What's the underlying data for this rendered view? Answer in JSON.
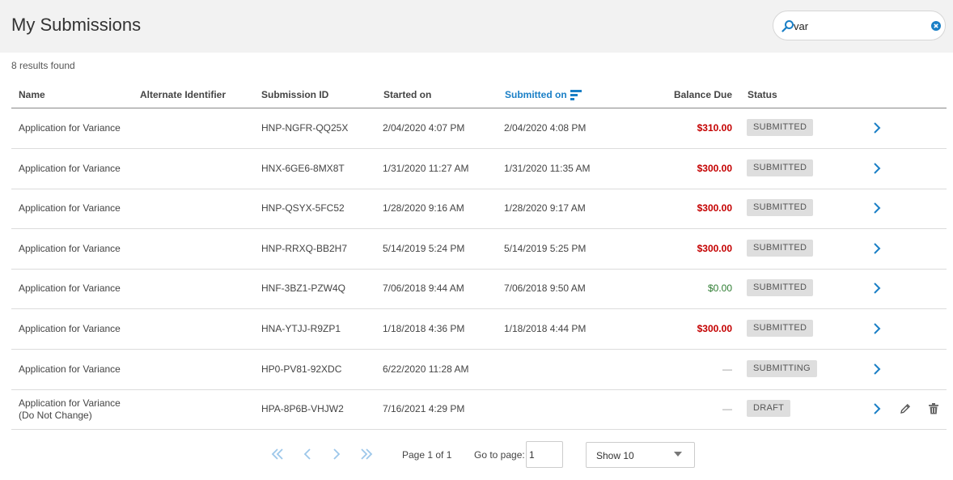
{
  "header": {
    "title": "My Submissions",
    "search_value": "var",
    "search_icon": "search-icon",
    "clear_icon": "clear-circle-icon"
  },
  "results_text": "8 results found",
  "columns": {
    "name": "Name",
    "alt_id": "Alternate Identifier",
    "submission_id": "Submission ID",
    "started_on": "Started on",
    "submitted_on": "Submitted on",
    "balance_due": "Balance Due",
    "status": "Status"
  },
  "sorted_column": "submitted_on",
  "colors": {
    "accent": "#1a7fc6",
    "balance_due": "#c40000",
    "balance_zero": "#2e7d32"
  },
  "rows": [
    {
      "name": "Application for Variance",
      "name2": "",
      "alt_id": "",
      "submission_id": "HNP-NGFR-QQ25X",
      "started_on": "2/04/2020 4:07 PM",
      "submitted_on": "2/04/2020 4:08 PM",
      "balance": "$310.00",
      "balance_state": "due",
      "status": "SUBMITTED",
      "actions": [
        "open"
      ]
    },
    {
      "name": "Application for Variance",
      "name2": "",
      "alt_id": "",
      "submission_id": "HNX-6GE6-8MX8T",
      "started_on": "1/31/2020 11:27 AM",
      "submitted_on": "1/31/2020 11:35 AM",
      "balance": "$300.00",
      "balance_state": "due",
      "status": "SUBMITTED",
      "actions": [
        "open"
      ]
    },
    {
      "name": "Application for Variance",
      "name2": "",
      "alt_id": "",
      "submission_id": "HNP-QSYX-5FC52",
      "started_on": "1/28/2020 9:16 AM",
      "submitted_on": "1/28/2020 9:17 AM",
      "balance": "$300.00",
      "balance_state": "due",
      "status": "SUBMITTED",
      "actions": [
        "open"
      ]
    },
    {
      "name": "Application for Variance",
      "name2": "",
      "alt_id": "",
      "submission_id": "HNP-RRXQ-BB2H7",
      "started_on": "5/14/2019 5:24 PM",
      "submitted_on": "5/14/2019 5:25 PM",
      "balance": "$300.00",
      "balance_state": "due",
      "status": "SUBMITTED",
      "actions": [
        "open"
      ]
    },
    {
      "name": "Application for Variance",
      "name2": "",
      "alt_id": "",
      "submission_id": "HNF-3BZ1-PZW4Q",
      "started_on": "7/06/2018 9:44 AM",
      "submitted_on": "7/06/2018 9:50 AM",
      "balance": "$0.00",
      "balance_state": "zero",
      "status": "SUBMITTED",
      "actions": [
        "open"
      ]
    },
    {
      "name": "Application for Variance",
      "name2": "",
      "alt_id": "",
      "submission_id": "HNA-YTJJ-R9ZP1",
      "started_on": "1/18/2018 4:36 PM",
      "submitted_on": "1/18/2018 4:44 PM",
      "balance": "$300.00",
      "balance_state": "due",
      "status": "SUBMITTED",
      "actions": [
        "open"
      ]
    },
    {
      "name": "Application for Variance",
      "name2": "",
      "alt_id": "",
      "submission_id": "HP0-PV81-92XDC",
      "started_on": "6/22/2020 11:28 AM",
      "submitted_on": "",
      "balance": "—",
      "balance_state": "none",
      "status": "SUBMITTING",
      "actions": [
        "open"
      ]
    },
    {
      "name": "Application for Variance",
      "name2": "(Do Not Change)",
      "alt_id": "",
      "submission_id": "HPA-8P6B-VHJW2",
      "started_on": "7/16/2021 4:29 PM",
      "submitted_on": "",
      "balance": "—",
      "balance_state": "none",
      "status": "DRAFT",
      "actions": [
        "open",
        "edit",
        "delete"
      ]
    }
  ],
  "pagination": {
    "page_info": "Page 1 of 1",
    "goto_label": "Go to page:",
    "goto_value": "1",
    "show_value": "Show 10"
  }
}
